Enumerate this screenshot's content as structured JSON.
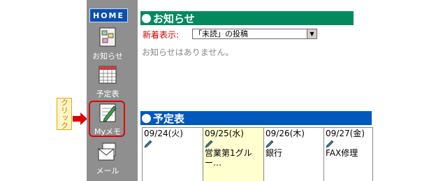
{
  "callout": {
    "text": "クリック"
  },
  "sidebar": {
    "home_label": "HOME",
    "items": [
      {
        "label": "お知らせ",
        "icon": "notice-icon"
      },
      {
        "label": "予定表",
        "icon": "calendar-icon"
      },
      {
        "label": "Myメモ",
        "icon": "memo-icon",
        "selected": true
      },
      {
        "label": "メール",
        "icon": "mail-icon"
      }
    ]
  },
  "notice": {
    "title": "お知らせ",
    "filter_label": "新着表示:",
    "filter_value": "「未読」の投稿",
    "empty_message": "お知らせはありません。"
  },
  "schedule": {
    "title": "予定表",
    "days": [
      {
        "date": "09/24(火)",
        "entries": []
      },
      {
        "date": "09/25(水)",
        "entries": [
          "営業第1グル",
          "ー…"
        ],
        "today": true
      },
      {
        "date": "09/26(木)",
        "entries": [
          "銀行"
        ]
      },
      {
        "date": "09/27(金)",
        "entries": [
          "FAX修理"
        ]
      }
    ]
  },
  "colors": {
    "sidebar_bg": "#8f8f8f",
    "home_tab": "#0a4fb0",
    "notice_header": "#008a5e",
    "schedule_header": "#0058bb",
    "highlight_border": "#e00000",
    "today_bg": "#ffffd0"
  }
}
